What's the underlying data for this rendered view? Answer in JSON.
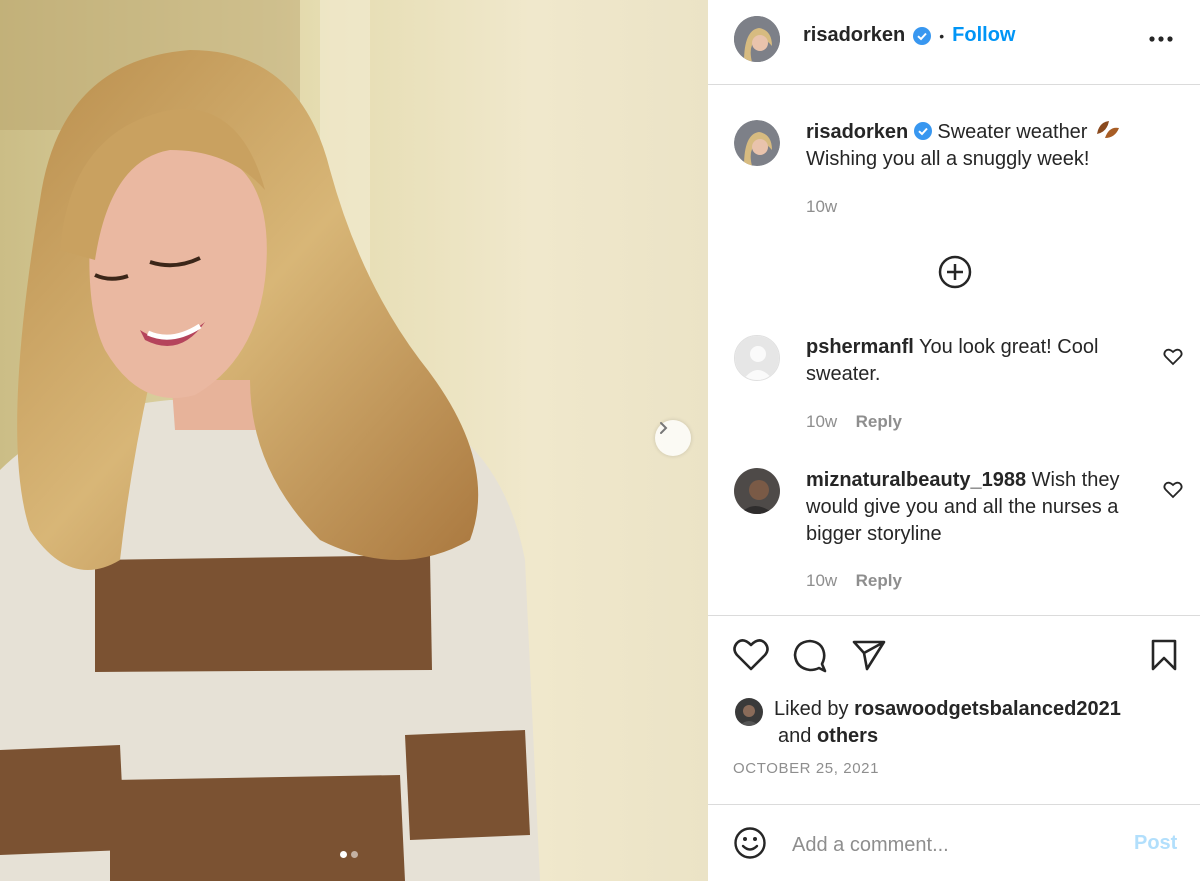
{
  "post": {
    "author": "risadorken",
    "follow_label": "Follow",
    "separator": "•",
    "more_icon": "more-horizontal-icon",
    "caption_text": "Sweater weather",
    "caption_line2": "Wishing you all a snuggly week!",
    "caption_emoji_icon": "leaves-icon",
    "caption_time": "10w",
    "load_more_icon": "plus-circle-icon"
  },
  "comments": [
    {
      "user": "pshermanfl",
      "text": "You look great! Cool sweater.",
      "time": "10w",
      "reply_label": "Reply"
    },
    {
      "user": "miznaturalbeauty_1988",
      "text": "Wish they would give you and all the nurses a bigger storyline",
      "time": "10w",
      "reply_label": "Reply"
    }
  ],
  "likes": {
    "prefix": "Liked by",
    "user": "rosawoodgetsbalanced2021",
    "and": "and",
    "others": "others"
  },
  "date": "OCTOBER 25, 2021",
  "composer": {
    "placeholder": "Add a comment...",
    "post_label": "Post",
    "emoji_icon": "smiley-icon"
  },
  "carousel": {
    "slides": 2,
    "active_slide": 1
  },
  "colors": {
    "link": "#0095f6",
    "verified": "#3897f0",
    "post_disabled": "#b2dffc"
  }
}
